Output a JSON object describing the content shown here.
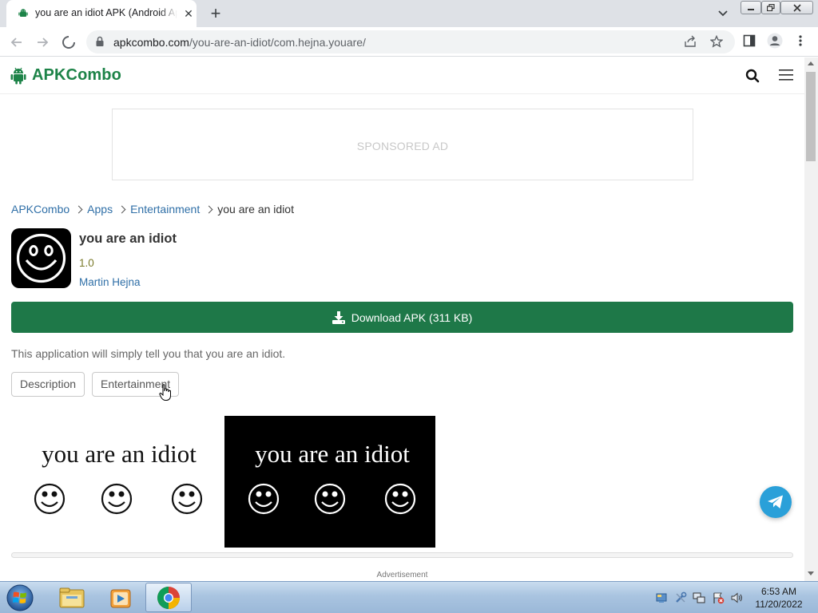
{
  "browser": {
    "tab_title": "you are an idiot APK (Android App) - Free Download",
    "url_host": "apkcombo.com",
    "url_path": "/you-are-an-idiot/com.hejna.youare/"
  },
  "site": {
    "brand": "APKCombo",
    "ad_placeholder": "SPONSORED AD",
    "breadcrumb": [
      {
        "label": "APKCombo"
      },
      {
        "label": "Apps"
      },
      {
        "label": "Entertainment"
      }
    ],
    "breadcrumb_current": "you are an idiot"
  },
  "app": {
    "name": "you are an idiot",
    "version": "1.0",
    "developer": "Martin Hejna",
    "download_label": "Download APK (311 KB)",
    "description": "This application will simply tell you that you are an idiot.",
    "tags": [
      "Description",
      "Entertainment"
    ]
  },
  "screenshots": [
    {
      "caption": "you are an idiot",
      "theme": "light"
    },
    {
      "caption": "you are an idiot",
      "theme": "dark"
    }
  ],
  "advertisement_label": "Advertisement",
  "taskbar": {
    "time": "6:53 AM",
    "date": "11/20/2022"
  },
  "colors": {
    "brand_green": "#1d8348",
    "download_green": "#1e7848",
    "link_blue": "#2f6fa7",
    "telegram_blue": "#2aa0d9"
  }
}
